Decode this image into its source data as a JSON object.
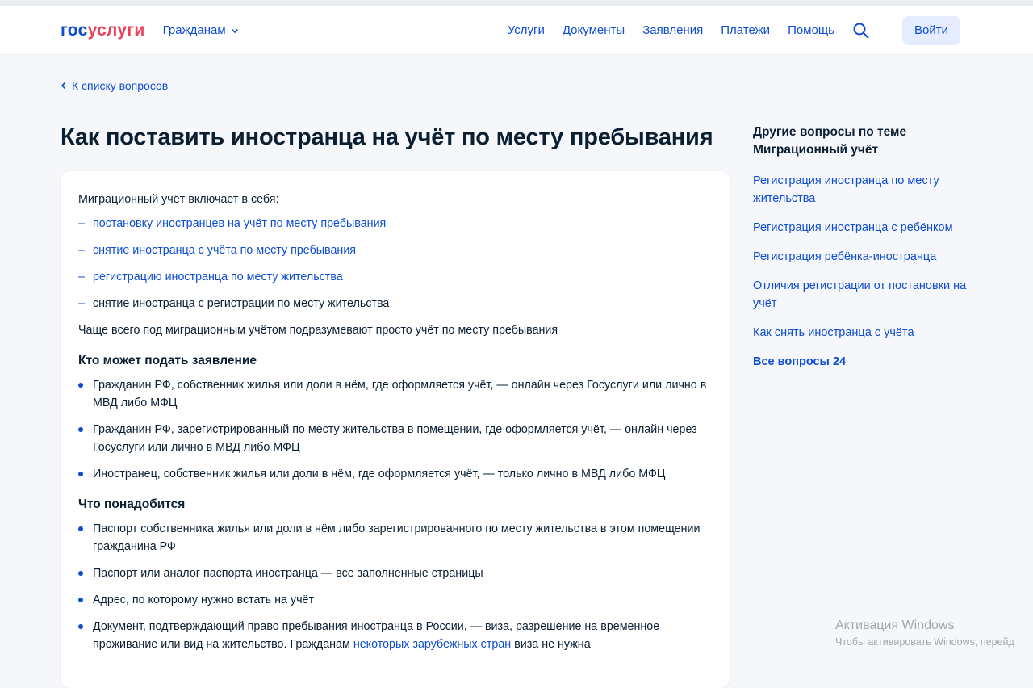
{
  "header": {
    "logo_part1": "гос",
    "logo_part2": "услуги",
    "audience": "Гражданам",
    "nav": [
      "Услуги",
      "Документы",
      "Заявления",
      "Платежи",
      "Помощь"
    ],
    "login": "Войти"
  },
  "back": "К списку вопросов",
  "title": "Как поставить иностранца на учёт по месту пребывания",
  "content": {
    "intro": "Миграционный учёт включает в себя:",
    "items": [
      {
        "text": "постановку иностранцев на учёт по месту пребывания"
      },
      {
        "text": "снятие иностранца с учёта по месту пребывания"
      },
      {
        "text": "регистрацию иностранца по месту жительства"
      },
      {
        "text": "снятие иностранца с регистрации по месту жительства"
      }
    ],
    "note": "Чаще всего под миграционным учётом подразумевают просто учёт по месту пребывания",
    "who_title": "Кто может подать заявление",
    "who": [
      "Гражданин РФ, собственник жилья или доли в нём, где оформляется учёт, — онлайн через Госуслуги или лично в МВД либо МФЦ",
      "Гражданин РФ, зарегистрированный по месту жительства в помещении, где оформляется учёт, — онлайн через Госуслуги или лично в МВД либо МФЦ",
      "Иностранец, собственник жилья или доли в нём, где оформляется учёт, — только лично в МВД либо МФЦ"
    ],
    "need_title": "Что понадобится",
    "need": [
      "Паспорт собственника жилья или доли в нём либо зарегистрированного по месту жительства в этом помещении гражданина РФ",
      "Паспорт или аналог паспорта иностранца — все заполненные страницы",
      "Адрес, по которому нужно встать на учёт"
    ],
    "need_doc_pre": "Документ, подтверждающий право пребывания иностранца в России, — виза, разрешение на временное проживание или вид на жительство. Гражданам ",
    "need_doc_link": "некоторых зарубежных стран",
    "need_doc_post": " виза не нужна"
  },
  "aside": {
    "title": "Другие вопросы по теме Миграционный учёт",
    "links": [
      "Регистрация иностранца по месту жительства",
      "Регистрация иностранца с ребёнком",
      "Регистрация ребёнка-иностранца",
      "Отличия регистрации от постановки на учёт",
      "Как снять иностранца с учёта"
    ],
    "all": "Все вопросы 24"
  },
  "watermark": {
    "line1": "Активация Windows",
    "line2": "Чтобы активировать Windows, перейд"
  },
  "colors": {
    "accent": "#0d4cd3",
    "logo_red": "#ee3f58",
    "text": "#0b1f33",
    "background": "#f5f7fa"
  }
}
